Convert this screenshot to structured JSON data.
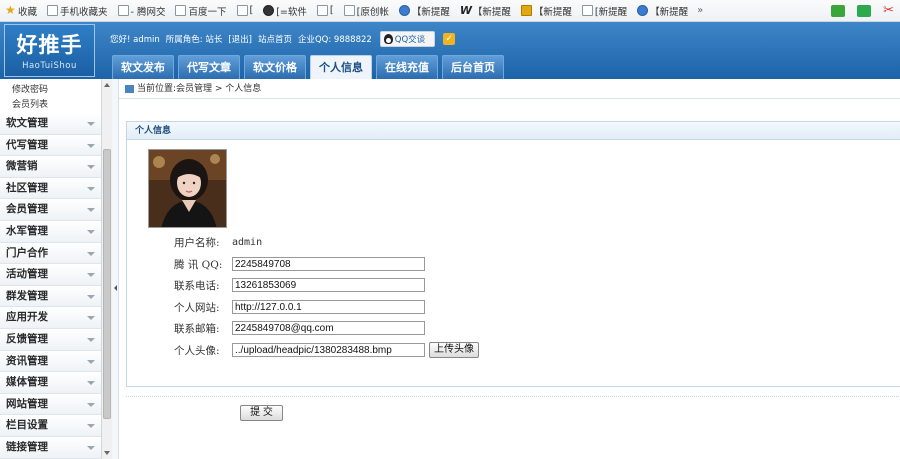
{
  "favorites": {
    "items": [
      {
        "label": "收藏",
        "icon": "star-icon"
      },
      {
        "label": "手机收藏夹",
        "icon": "page-icon"
      },
      {
        "label": "- 腾网交",
        "icon": "page-icon"
      },
      {
        "label": "百度一下",
        "icon": "page-icon"
      },
      {
        "label": "[",
        "icon": "page-icon"
      },
      {
        "label": "[=软件",
        "icon": "cursor-icon"
      },
      {
        "label": "[",
        "icon": "page-icon"
      },
      {
        "label": "[原创帐",
        "icon": "page-icon"
      },
      {
        "label": "【新提醒",
        "icon": "globe-icon"
      },
      {
        "label": "【新提醒",
        "icon": "w-icon"
      },
      {
        "label": "【新提醒",
        "icon": "gold-icon"
      },
      {
        "label": "[新提醒",
        "icon": "page-icon"
      },
      {
        "label": "【新提醒",
        "icon": "globe-icon"
      }
    ],
    "more": "»"
  },
  "header": {
    "logo_main": "好推手",
    "logo_sub": "HaoTuiShou",
    "greeting": "您好! admin",
    "role": "所属角色: 站长",
    "logout": "[退出]",
    "site_home": "站点首页",
    "company_qq": "企业QQ: 9888822",
    "qq_button": "QQ交谈",
    "check_mark": "✓"
  },
  "nav": {
    "tabs": [
      "软文发布",
      "代写文章",
      "软文价格",
      "个人信息",
      "在线充值",
      "后台首页"
    ],
    "active_index": 3
  },
  "sidebar": {
    "subitems": [
      "修改密码",
      "会员列表"
    ],
    "items": [
      "软文管理",
      "代写管理",
      "微营销",
      "社区管理",
      "会员管理",
      "水军管理",
      "门户合作",
      "活动管理",
      "群发管理",
      "应用开发",
      "反馈管理",
      "资讯管理",
      "媒体管理",
      "网站管理",
      "栏目设置",
      "链接管理"
    ]
  },
  "breadcrumb": {
    "prefix": "当前位置: ",
    "path": "会员管理 > 个人信息"
  },
  "panel": {
    "title": "个人信息",
    "username_label": "用户名称:",
    "username_value": "admin",
    "qq_label": "腾 讯 QQ:",
    "qq_value": "2245849708",
    "phone_label": "联系电话:",
    "phone_value": "13261853069",
    "website_label": "个人网站:",
    "website_value": "http://127.0.0.1",
    "email_label": "联系邮箱:",
    "email_value": "2245849708@qq.com",
    "avatar_label": "个人头像:",
    "avatar_value": "../upload/headpic/1380283488.bmp",
    "upload_button": "上传头像",
    "submit_button": "提 交"
  },
  "colors": {
    "header_blue": "#1d63a8",
    "tab_active_bg": "#eef4fa",
    "panel_border": "#c5d6e7"
  }
}
